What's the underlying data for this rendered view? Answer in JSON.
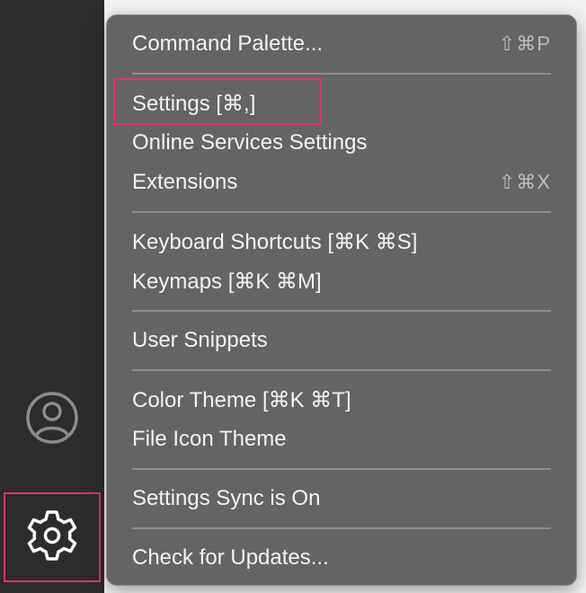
{
  "colors": {
    "activity_bar": "#2c2c2c",
    "menu_bg": "#646464",
    "menu_text": "#f2f2f2",
    "shortcut_text": "#bdbdbd",
    "highlight": "#e0336a"
  },
  "activity_bar": {
    "account_icon": "account-icon",
    "manage_icon": "gear-icon"
  },
  "menu": {
    "items": [
      {
        "label": "Command Palette...",
        "shortcut": "⇧⌘P"
      },
      {
        "label": "Settings [⌘,]",
        "shortcut": ""
      },
      {
        "label": "Online Services Settings",
        "shortcut": ""
      },
      {
        "label": "Extensions",
        "shortcut": "⇧⌘X"
      },
      {
        "label": "Keyboard Shortcuts [⌘K ⌘S]",
        "shortcut": ""
      },
      {
        "label": "Keymaps [⌘K ⌘M]",
        "shortcut": ""
      },
      {
        "label": "User Snippets",
        "shortcut": ""
      },
      {
        "label": "Color Theme [⌘K ⌘T]",
        "shortcut": ""
      },
      {
        "label": "File Icon Theme",
        "shortcut": ""
      },
      {
        "label": "Settings Sync is On",
        "shortcut": ""
      },
      {
        "label": "Check for Updates...",
        "shortcut": ""
      }
    ]
  }
}
